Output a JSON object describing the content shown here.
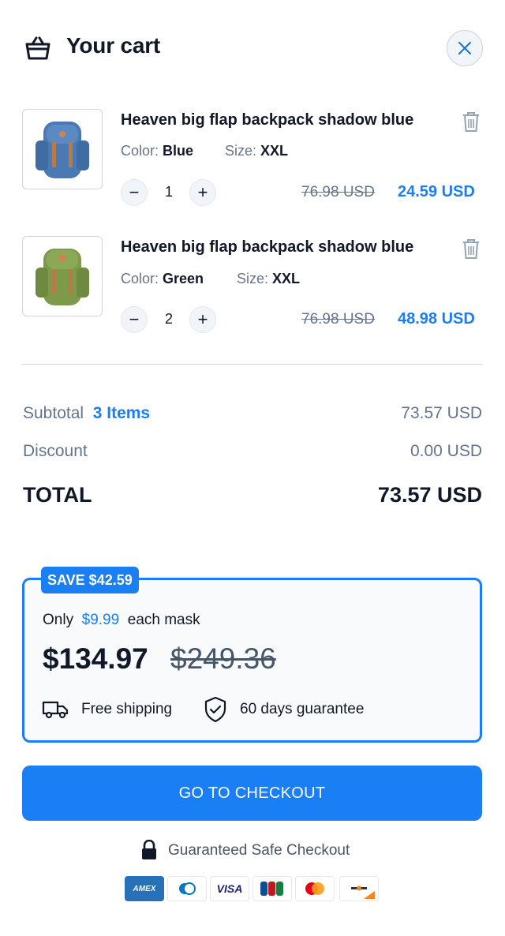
{
  "header": {
    "title": "Your cart",
    "icon": "basket-icon",
    "close_icon": "close-icon"
  },
  "items": [
    {
      "title": "Heaven big flap backpack shadow blue",
      "color_label": "Color:",
      "color": "Blue",
      "size_label": "Size:",
      "size": "XXL",
      "qty": "1",
      "old_price": "76.98 USD",
      "price": "24.59 USD",
      "product_color": "#4b79b3"
    },
    {
      "title": "Heaven big flap backpack shadow blue",
      "color_label": "Color:",
      "color": "Green",
      "size_label": "Size:",
      "size": "XXL",
      "qty": "2",
      "old_price": "76.98 USD",
      "price": "48.98 USD",
      "product_color": "#7d9a4a"
    }
  ],
  "summary": {
    "subtotal_label": "Subtotal",
    "subtotal_items": "3 Items",
    "subtotal_value": "73.57 USD",
    "discount_label": "Discount",
    "discount_value": "0.00 USD",
    "total_label": "TOTAL",
    "total_value": "73.57 USD"
  },
  "offer": {
    "badge": "SAVE $42.59",
    "only": "Only",
    "unit_price": "$9.99",
    "unit_suffix": "each mask",
    "price": "$134.97",
    "old_price": "$249.36",
    "shipping": "Free shipping",
    "guarantee": "60 days guarantee"
  },
  "checkout": {
    "button": "GO TO CHECKOUT",
    "safe": "Guaranteed Safe Checkout"
  },
  "payment_cards": {
    "amex": "AMEX",
    "visa": "VISA"
  },
  "colors": {
    "accent": "#1a7ef5",
    "text": "#111827",
    "muted": "#64748b"
  }
}
